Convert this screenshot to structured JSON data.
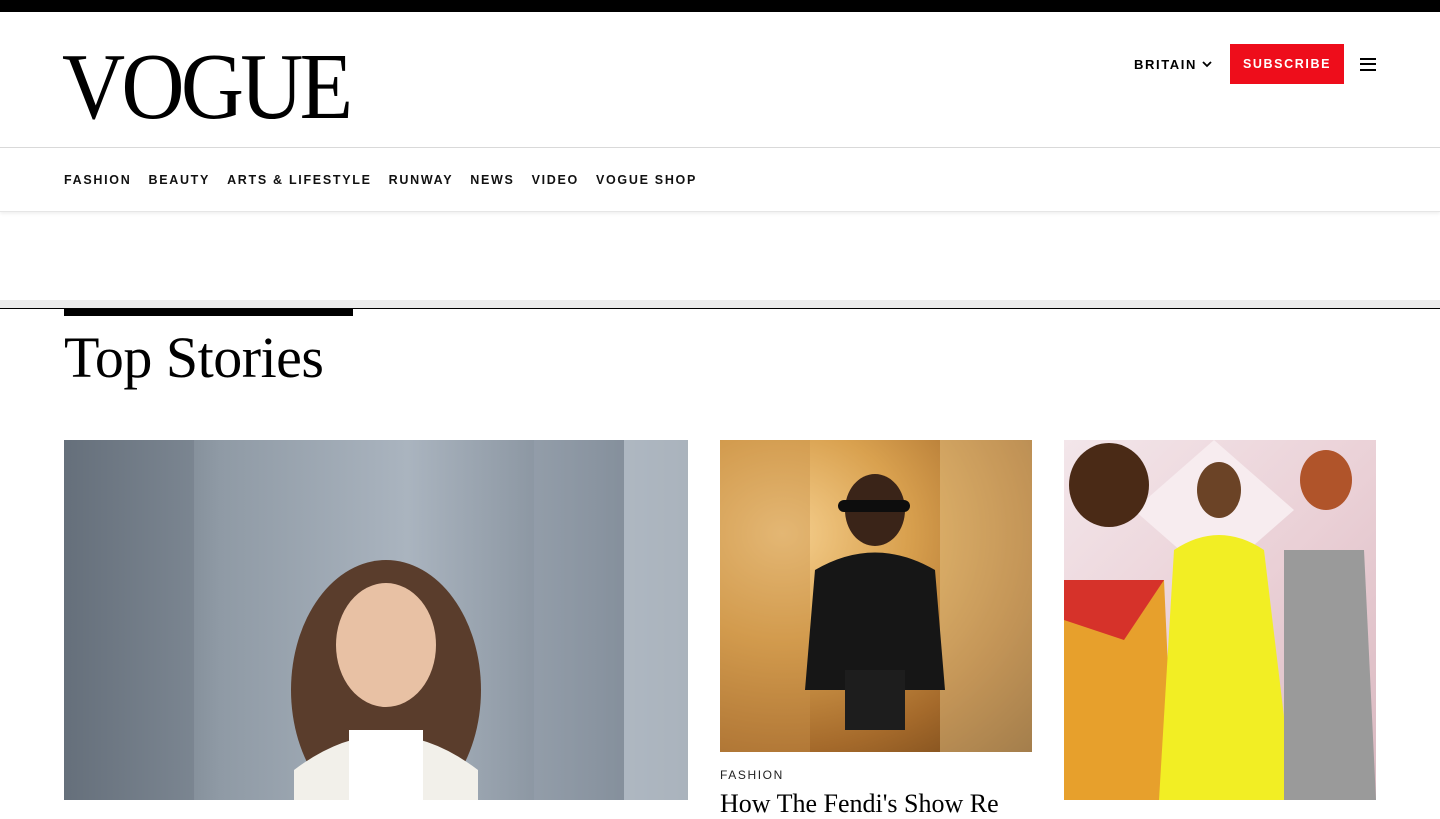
{
  "header": {
    "logo": "VOGUE",
    "edition": "BRITAIN",
    "subscribe": "SUBSCRIBE"
  },
  "nav": {
    "items": [
      "FASHION",
      "BEAUTY",
      "ARTS & LIFESTYLE",
      "RUNWAY",
      "NEWS",
      "VIDEO",
      "VOGUE SHOP"
    ]
  },
  "section": {
    "title": "Top Stories"
  },
  "cards": [
    {
      "rubric": "",
      "headline": ""
    },
    {
      "rubric": "FASHION",
      "headline": "How The Fendi's Show Re"
    },
    {
      "rubric": "",
      "headline": ""
    }
  ],
  "colors": {
    "accent": "#ee0d1b",
    "text": "#000000"
  },
  "icons": {
    "edition": "chevron-down-icon",
    "menu": "hamburger-menu-icon"
  }
}
